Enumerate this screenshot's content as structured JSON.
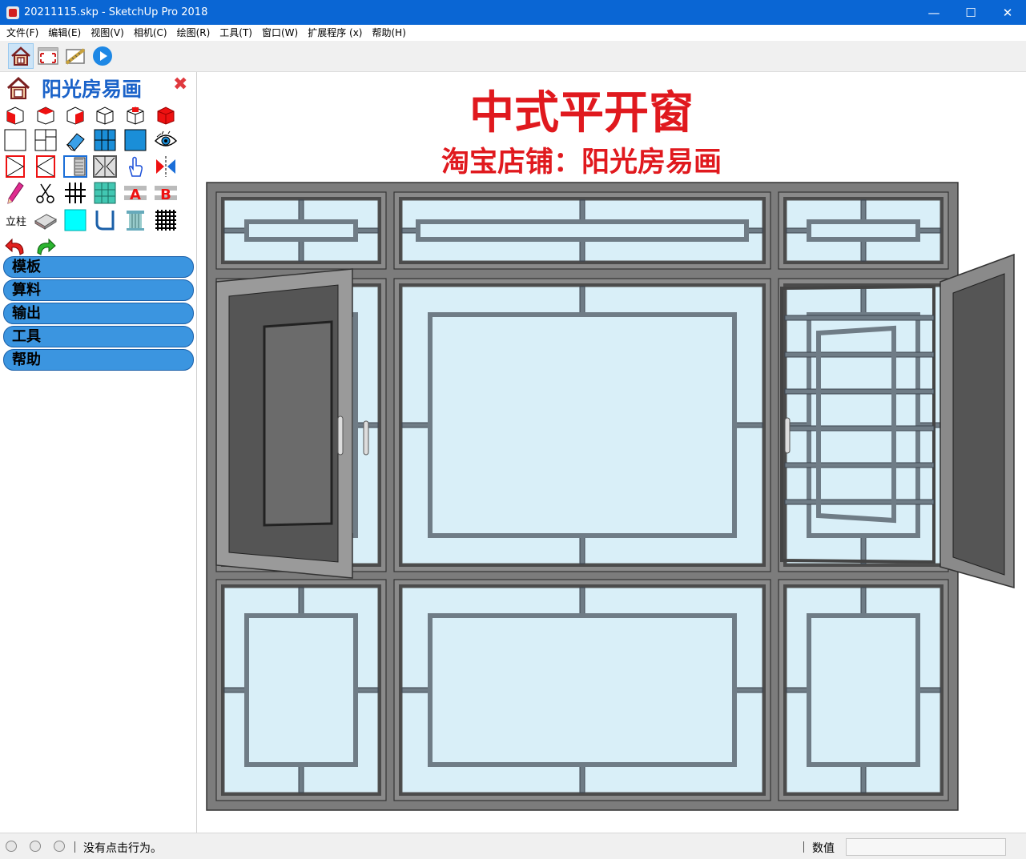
{
  "window": {
    "title": "20211115.skp - SketchUp Pro 2018",
    "minimize": "—",
    "maximize": "☐",
    "close": "✕"
  },
  "menu": [
    {
      "label": "文件(F)"
    },
    {
      "label": "编辑(E)"
    },
    {
      "label": "视图(V)"
    },
    {
      "label": "相机(C)"
    },
    {
      "label": "绘图(R)"
    },
    {
      "label": "工具(T)"
    },
    {
      "label": "窗口(W)"
    },
    {
      "label": "扩展程序 (x)"
    },
    {
      "label": "帮助(H)"
    }
  ],
  "toolbar": {
    "icons": [
      "house-icon",
      "zoom-extents-icon",
      "measure-icon",
      "play-icon"
    ]
  },
  "panel": {
    "title": "阳光房易画",
    "close_label": "✖",
    "tool_text": "立柱",
    "nav": [
      {
        "label": "模板"
      },
      {
        "label": "算料"
      },
      {
        "label": "输出"
      },
      {
        "label": "工具"
      },
      {
        "label": "帮助"
      }
    ]
  },
  "canvas": {
    "title": "中式平开窗",
    "subtitle": "淘宝店铺：阳光房易画",
    "colors": {
      "frame": "#7c7c7c",
      "frame_dark": "#4b4b4b",
      "glass": "#d9eff8",
      "bar": "#6f7c86"
    }
  },
  "status": {
    "message": "没有点击行为。",
    "value_label": "数值",
    "value": ""
  }
}
